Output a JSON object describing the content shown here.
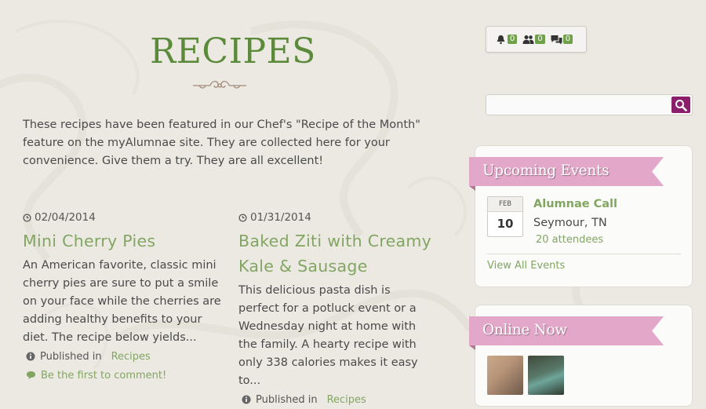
{
  "page": {
    "title": "RECIPES",
    "intro": "These recipes have been featured in our Chef's \"Recipe of the Month\" feature on the myAlumnae site. They are collected here for your convenience. Give them a try. They are all excellent!"
  },
  "posts": [
    {
      "date": "02/04/2014",
      "title": "Mini Cherry Pies",
      "excerpt": "An American favorite, classic mini cherry pies are sure to put a smile on your face while the cherries are adding healthy benefits to your diet. The recipe below yields...",
      "published_label": "Published in",
      "category": "Recipes",
      "comment_text": "Be the first to comment!"
    },
    {
      "date": "01/31/2014",
      "title": "Baked Ziti with Creamy Kale & Sausage",
      "excerpt": "This delicious pasta dish is perfect for a potluck event or a Wednesday night at home with the family. A hearty recipe with only 338 calories makes it easy to...",
      "published_label": "Published in",
      "category": "Recipes"
    }
  ],
  "notifications": {
    "alerts": "0",
    "friends": "0",
    "messages": "0"
  },
  "search": {
    "placeholder": ""
  },
  "events_widget": {
    "heading": "Upcoming Events",
    "event": {
      "month": "FEB",
      "day": "10",
      "title": "Alumnae Call",
      "location": "Seymour, TN",
      "attendees": "20 attendees"
    },
    "view_all": "View All Events"
  },
  "online_widget": {
    "heading": "Online Now"
  },
  "colors": {
    "accent_green": "#82a662",
    "title_green": "#5c8a3b",
    "ribbon_pink": "#e3a7c9",
    "search_purple": "#8c1f6b"
  },
  "icons": {
    "date": "clock-icon",
    "published": "info-icon",
    "comment": "comment-icon",
    "alerts": "bell-icon",
    "friends": "users-icon",
    "messages": "chat-icon",
    "search": "search-icon"
  }
}
